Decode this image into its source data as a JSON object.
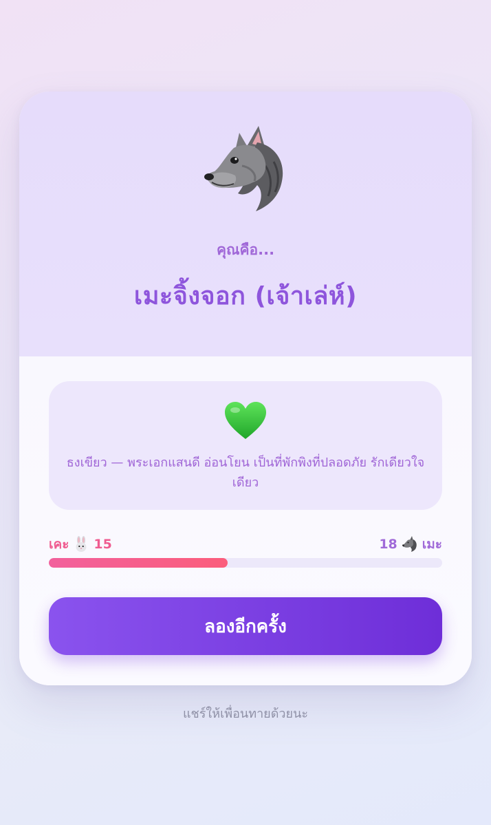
{
  "result": {
    "avatar_icon": "wolf-icon",
    "intro_label": "คุณคือ...",
    "title": "เมะจิ้งจอก (เจ้าเล่ห์)"
  },
  "description": {
    "icon": "green-heart-icon",
    "text": "ธงเขียว — พระเอกแสนดี อ่อนโยน เป็นที่พักพิงที่ปลอดภัย รักเดียวใจเดียว"
  },
  "score": {
    "left_label": "เคะ",
    "left_icon": "rabbit-icon",
    "left_value": "15",
    "right_value": "18",
    "right_icon": "wolf-icon",
    "right_label": "เมะ",
    "fill_fraction": 0.455,
    "fill_color": "#f2609c"
  },
  "actions": {
    "retry_label": "ลองอีกครั้ง"
  },
  "footer": {
    "share_note": "แชร์ให้เพื่อนทายด้วยนะ"
  },
  "colors": {
    "accent_purple": "#8e55dc",
    "button_gradient_start": "#8a53ee",
    "button_gradient_end": "#6e2ed8",
    "pink": "#ef5b8f"
  }
}
